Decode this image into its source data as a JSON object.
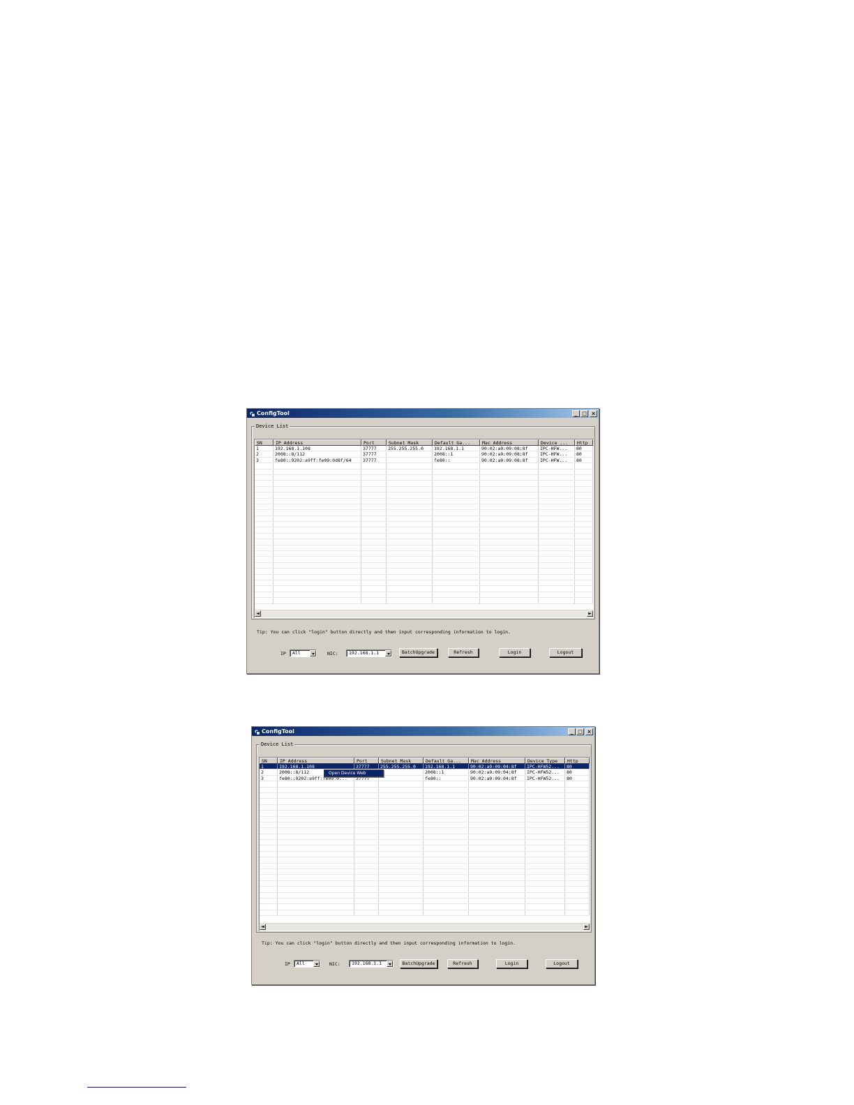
{
  "windows": [
    {
      "title": "ConfigTool",
      "controls": {
        "minimize": "_",
        "maximize": "□",
        "close": "×"
      },
      "group_label": "Device List",
      "columns": [
        "SN",
        "IP Address",
        "Port",
        "Subnet Mask",
        "Default Ga...",
        "Mac Address",
        "Device ...",
        "Http"
      ],
      "rows": [
        [
          "1",
          "192.168.1.108",
          "37777",
          "255.255.255.0",
          "192.168.1.1",
          "90:02:a9:09:08:8f",
          "IPC-HFW...",
          "80"
        ],
        [
          "2",
          "2008::8/112",
          "37777",
          "",
          "2008::1",
          "90:02:a9:09:08:8f",
          "IPC-HFW...",
          "80"
        ],
        [
          "3",
          "fe80::9202:a9ff:fe09:0d8f/64",
          "37777",
          "",
          "fe80::",
          "90:02:a9:09:08:8f",
          "IPC-HFW...",
          "80"
        ]
      ],
      "scroll": {
        "left": "◄",
        "right": "►"
      },
      "tip": "Tip: You can click \"login\" button directly and then input corresponding information to login.",
      "ip_label": "IP",
      "ip_value": "All",
      "nic_label": "NIC:",
      "nic_value": "192.168.1.1",
      "buttons": {
        "batch": "BatchUpgrade",
        "refresh": "Refresh",
        "login": "Login",
        "logout": "Logout"
      }
    },
    {
      "title": "ConfigTool",
      "controls": {
        "minimize": "_",
        "maximize": "□",
        "close": "×"
      },
      "group_label": "Device List",
      "columns": [
        "SN",
        "IP Address",
        "Port",
        "Subnet Mask",
        "Default Ga...",
        "Mac Address",
        "Device Type",
        "Http"
      ],
      "rows": [
        [
          "1",
          "192.168.1.108",
          "37777",
          "255.255.255.0",
          "192.168.1.1",
          "90:02:a9:09:04:8f",
          "IPC-HFW52...",
          "80"
        ],
        [
          "2",
          "2008::8/112",
          "37777",
          "",
          "2008::1",
          "90:02:a9:09:04:8f",
          "IPC-HFW52...",
          "80"
        ],
        [
          "3",
          "fe80::9202:a9ff:fe09:0...",
          "37777",
          "",
          "fe80::",
          "90:02:a9:09:04:8f",
          "IPC-HFW52...",
          "80"
        ]
      ],
      "context_menu": "Open Device Web",
      "scroll": {
        "left": "◄",
        "right": "►"
      },
      "tip": "Tip: You can click \"login\" button directly and then input corresponding information to login.",
      "ip_label": "IP",
      "ip_value": "All",
      "nic_label": "NIC:",
      "nic_value": "192.168.1.1",
      "buttons": {
        "batch": "BatchUpgrade",
        "refresh": "Refresh",
        "login": "Login",
        "logout": "Logout"
      }
    }
  ]
}
